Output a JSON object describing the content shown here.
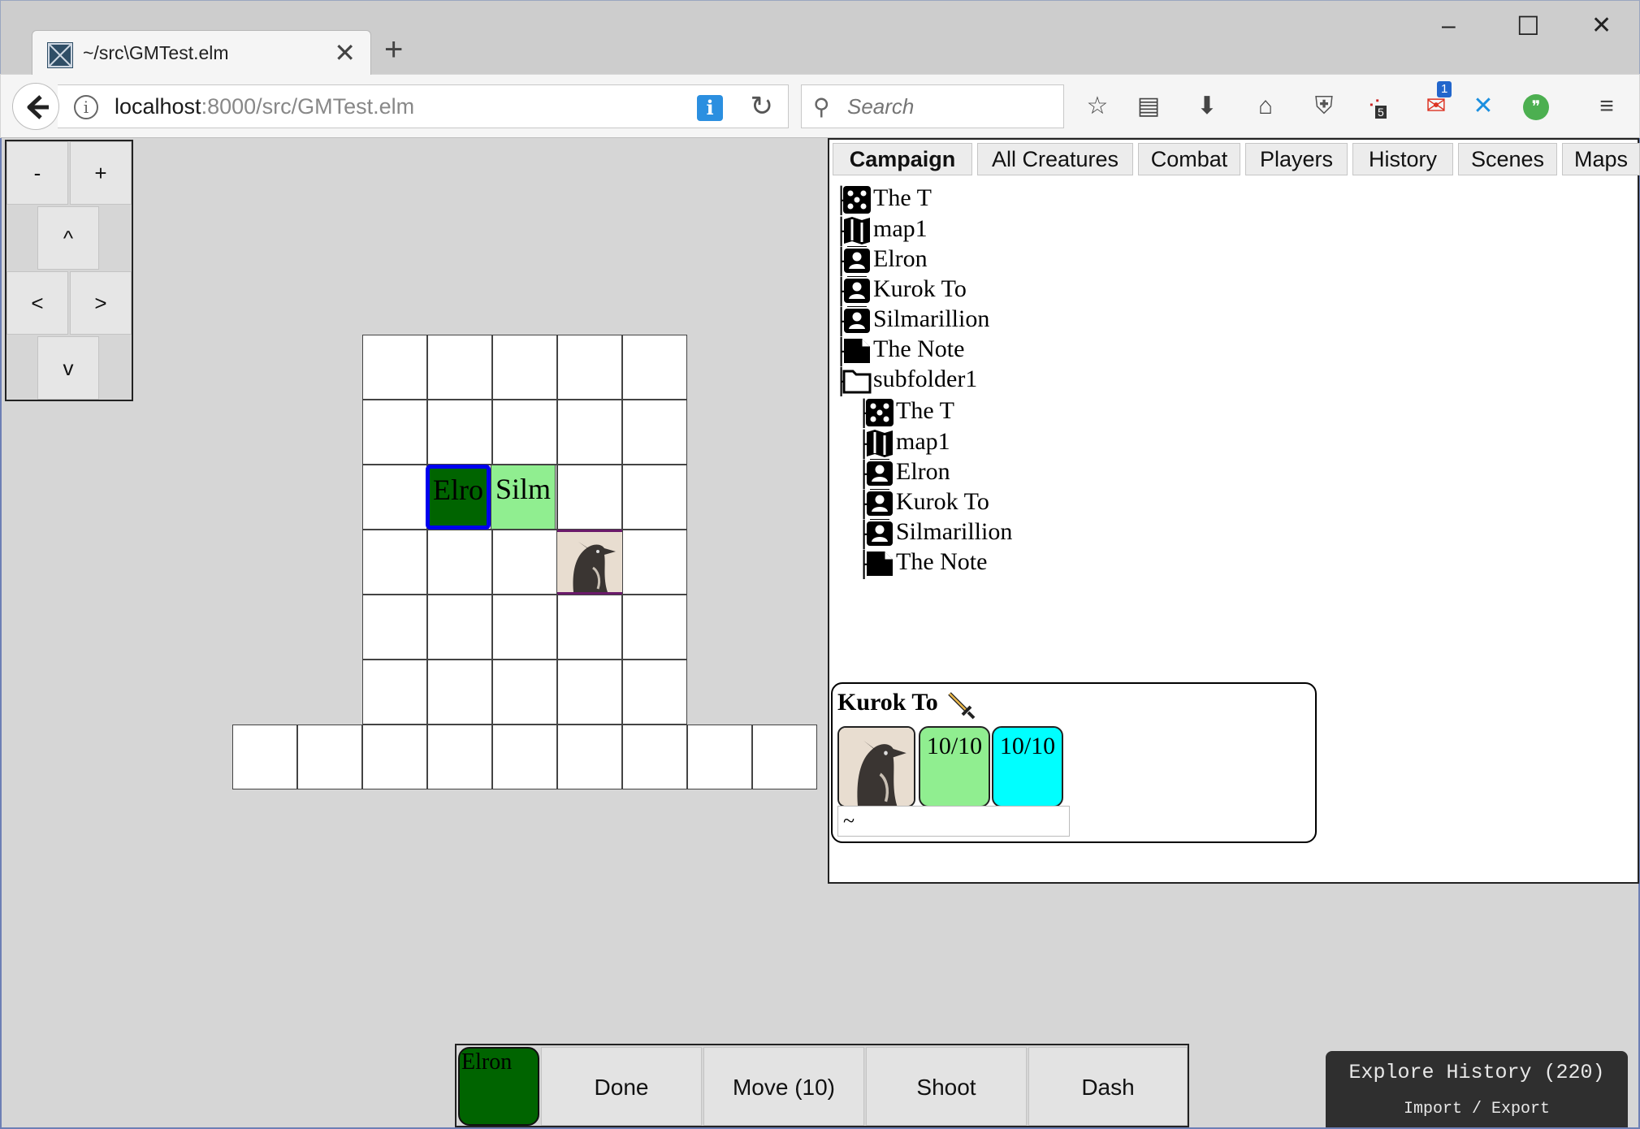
{
  "browser": {
    "tab_title": "~/src\\GMTest.elm",
    "url_host": "localhost",
    "url_path": ":8000/src/GMTest.elm",
    "search_placeholder": "Search",
    "new_tab": "+",
    "tab_close": "✕",
    "window_min": "–",
    "window_max": "☐",
    "window_close": "✕",
    "notification_badge": "1",
    "download_badge": "5"
  },
  "pan_controls": {
    "zoom_out": "-",
    "zoom_in": "+",
    "up": "^",
    "left": "<",
    "right": ">",
    "down": "v"
  },
  "map": {
    "tokens": [
      {
        "label": "Elro",
        "color": "#006400",
        "selected": true
      },
      {
        "label": "Silm",
        "color": "#90ee90",
        "selected": false
      }
    ],
    "selection_color": "#0000ee"
  },
  "panel": {
    "tabs": [
      "Campaign",
      "All Creatures",
      "Combat",
      "Players",
      "History",
      "Scenes",
      "Maps"
    ],
    "tree": [
      {
        "icon": "dice-icon",
        "label": "The T"
      },
      {
        "icon": "map-icon",
        "label": "map1"
      },
      {
        "icon": "creature-icon",
        "label": "Elron"
      },
      {
        "icon": "creature-icon",
        "label": "Kurok To"
      },
      {
        "icon": "creature-icon",
        "label": "Silmarillion"
      },
      {
        "icon": "note-icon",
        "label": "The Note"
      },
      {
        "icon": "folder-icon",
        "label": "subfolder1"
      },
      {
        "icon": "dice-icon",
        "label": "The T"
      },
      {
        "icon": "map-icon",
        "label": "map1"
      },
      {
        "icon": "creature-icon",
        "label": "Elron"
      },
      {
        "icon": "creature-icon",
        "label": "Kurok To"
      },
      {
        "icon": "creature-icon",
        "label": "Silmarillion"
      },
      {
        "icon": "note-icon",
        "label": "The Note"
      }
    ],
    "tree_connector": "├"
  },
  "creature_card": {
    "name": "Kurok To",
    "hp": "10/10",
    "hp_color": "#90ee90",
    "other_stat": "10/10",
    "other_stat_color": "#00ffff",
    "condition_value": "~"
  },
  "action_bar": {
    "actor": "Elron",
    "actor_color": "#006400",
    "buttons": [
      "Done",
      "Move (10)",
      "Shoot",
      "Dash"
    ]
  },
  "history_widget": {
    "title": "Explore History (220)",
    "subtitle": "Import / Export"
  }
}
